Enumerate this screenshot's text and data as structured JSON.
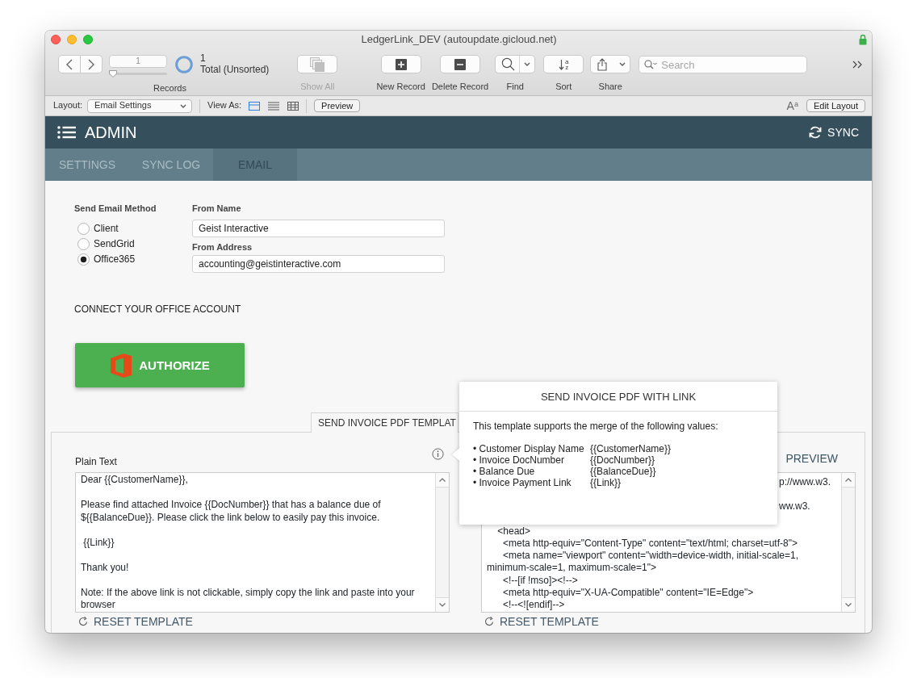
{
  "window": {
    "title": "LedgerLink_DEV (autoupdate.gicloud.net)"
  },
  "toolbar": {
    "record_number": "1",
    "record_slider": {
      "level": 0
    },
    "found_count": "1",
    "sort_status": "Total (Unsorted)",
    "records_label": "Records",
    "buttons": [
      {
        "kind": "show_all",
        "label": "Show All",
        "disabled": true,
        "menu": false
      },
      {
        "kind": "new_record",
        "label": "New Record",
        "disabled": false,
        "menu": false
      },
      {
        "kind": "delete_record",
        "label": "Delete Record",
        "disabled": false,
        "menu": false
      },
      {
        "kind": "find",
        "label": "Find",
        "disabled": false,
        "menu": true
      },
      {
        "kind": "sort",
        "label": "Sort",
        "disabled": false,
        "menu": false,
        "glyph": [
          "a",
          "z"
        ]
      },
      {
        "kind": "share",
        "label": "Share",
        "disabled": false,
        "menu": true
      }
    ],
    "search": {
      "placeholder": "Search"
    }
  },
  "layout_bar": {
    "layout_label": "Layout:",
    "layout": "Email Settings",
    "view_as_label": "View As:",
    "views": [
      {
        "kind": "form",
        "selected": true
      },
      {
        "kind": "list",
        "selected": false
      },
      {
        "kind": "table",
        "selected": false
      }
    ],
    "preview_button": "Preview",
    "text_format_glyph": "A$^{a}$",
    "edit_layout_button": "Edit Layout"
  },
  "app_header": {
    "title": "ADMIN",
    "sync_button": "SYNC"
  },
  "tabs": [
    {
      "label": "SETTINGS",
      "selected": false
    },
    {
      "label": "SYNC LOG",
      "selected": false
    },
    {
      "label": "EMAIL",
      "selected": true
    }
  ],
  "email_settings": {
    "method_label": "Send Email Method",
    "methods": [
      {
        "label": "Client",
        "selected": false
      },
      {
        "label": "SendGrid",
        "selected": false
      },
      {
        "label": "Office365",
        "selected": true
      }
    ],
    "from_name": {
      "label": "From Name",
      "value": "Geist Interactive"
    },
    "from_address": {
      "label": "From Address",
      "value": "accounting@geistinteractive.com"
    },
    "connect_heading": "CONNECT YOUR OFFICE ACCOUNT",
    "authorize_button": "AUTHORIZE"
  },
  "template_panel": {
    "tab": "SEND INVOICE PDF TEMPLAT",
    "plain_text": {
      "label": "Plain Text",
      "value": "Dear {{CustomerName}},\n\nPlease find attached Invoice {{DocNumber}} that has a balance due of ${{BalanceDue}}. Please click the link below to easily pay this invoice.\n\n {{Link}}\n\nThank you!\n\nNote: If the above link is not clickable, simply copy the link and paste into your browser"
    },
    "html": {
      "preview_button": "PREVIEW",
      "lines": [
        {
          "kind": "covered",
          "text": "p://www.w3."
        },
        {
          "kind": "covered",
          "text": "ww.w3."
        },
        {
          "kind": "code",
          "text": "    <head>"
        },
        {
          "kind": "code",
          "text": "      <meta http-equiv=\"Content-Type\" content=\"text/html; charset=utf-8\">"
        },
        {
          "kind": "code",
          "text": "      <meta name=\"viewport\" content=\"width=device-width, initial-scale=1, minimum-scale=1, maximum-scale=1\">"
        },
        {
          "kind": "code",
          "text": "      <!--[if !mso]><!-->"
        },
        {
          "kind": "code",
          "text": "      <meta http-equiv=\"X-UA-Compatible\" content=\"IE=Edge\">"
        },
        {
          "kind": "code",
          "text": "      <!--<![endif]-->"
        }
      ]
    },
    "reset_buttons": [
      "RESET TEMPLATE",
      "RESET TEMPLATE"
    ]
  },
  "merge_popover": {
    "title": "SEND INVOICE PDF WITH LINK",
    "intro": "This template supports the merge of the following values:",
    "fields": [
      {
        "name": "• Customer Display Name",
        "token": "{{CustomerName}}"
      },
      {
        "name": "• Invoice DocNumber",
        "token": "{{DocNumber}}"
      },
      {
        "name": "• Balance Due",
        "token": "{{BalanceDue}}"
      },
      {
        "name": "• Invoice Payment Link",
        "token": "{{Link}}"
      }
    ]
  }
}
